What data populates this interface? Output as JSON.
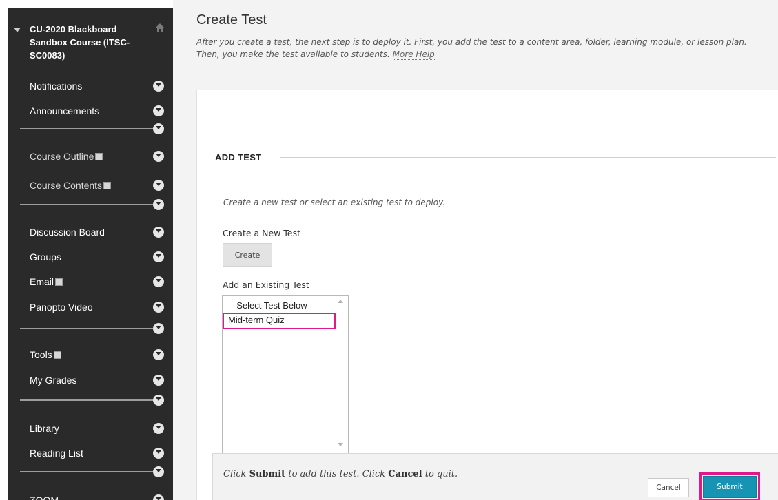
{
  "sidebar": {
    "course_title": "CU-2020 Blackboard Sandbox Course (ITSC-SC0083)",
    "items": [
      {
        "label": "Notifications"
      },
      {
        "label": "Announcements"
      },
      {
        "label": "Course Outline"
      },
      {
        "label": "Course Contents"
      },
      {
        "label": "Discussion Board"
      },
      {
        "label": "Groups"
      },
      {
        "label": "Email"
      },
      {
        "label": "Panopto Video"
      },
      {
        "label": "Tools"
      },
      {
        "label": "My Grades"
      },
      {
        "label": "Library"
      },
      {
        "label": "Reading List"
      },
      {
        "label": "ZOOM"
      }
    ]
  },
  "main": {
    "title": "Create Test",
    "intro_line1": "After you create a test, the next step is to deploy it. First, you add the test to a content area, folder, learning module, or lesson plan.",
    "intro_line2": "Then, you make the test available to students.",
    "more_help": "More Help"
  },
  "add_test": {
    "heading": "ADD TEST",
    "instructions": "Create a new test or select an existing test to deploy.",
    "new_label": "Create a New Test",
    "create_button": "Create",
    "existing_label": "Add an Existing Test",
    "options": [
      "-- Select Test Below --",
      "Mid-term Quiz"
    ]
  },
  "submit_bar": {
    "text_click": "Click",
    "text_submit": "Submit",
    "text_middle": "to add this test. Click",
    "text_cancel": "Cancel",
    "text_end": "to quit.",
    "cancel_button": "Cancel",
    "submit_button": "Submit"
  },
  "colors": {
    "sidebar_bg": "#2a2a2a",
    "highlight": "#e0198a",
    "submit_bg": "#1794b3"
  }
}
